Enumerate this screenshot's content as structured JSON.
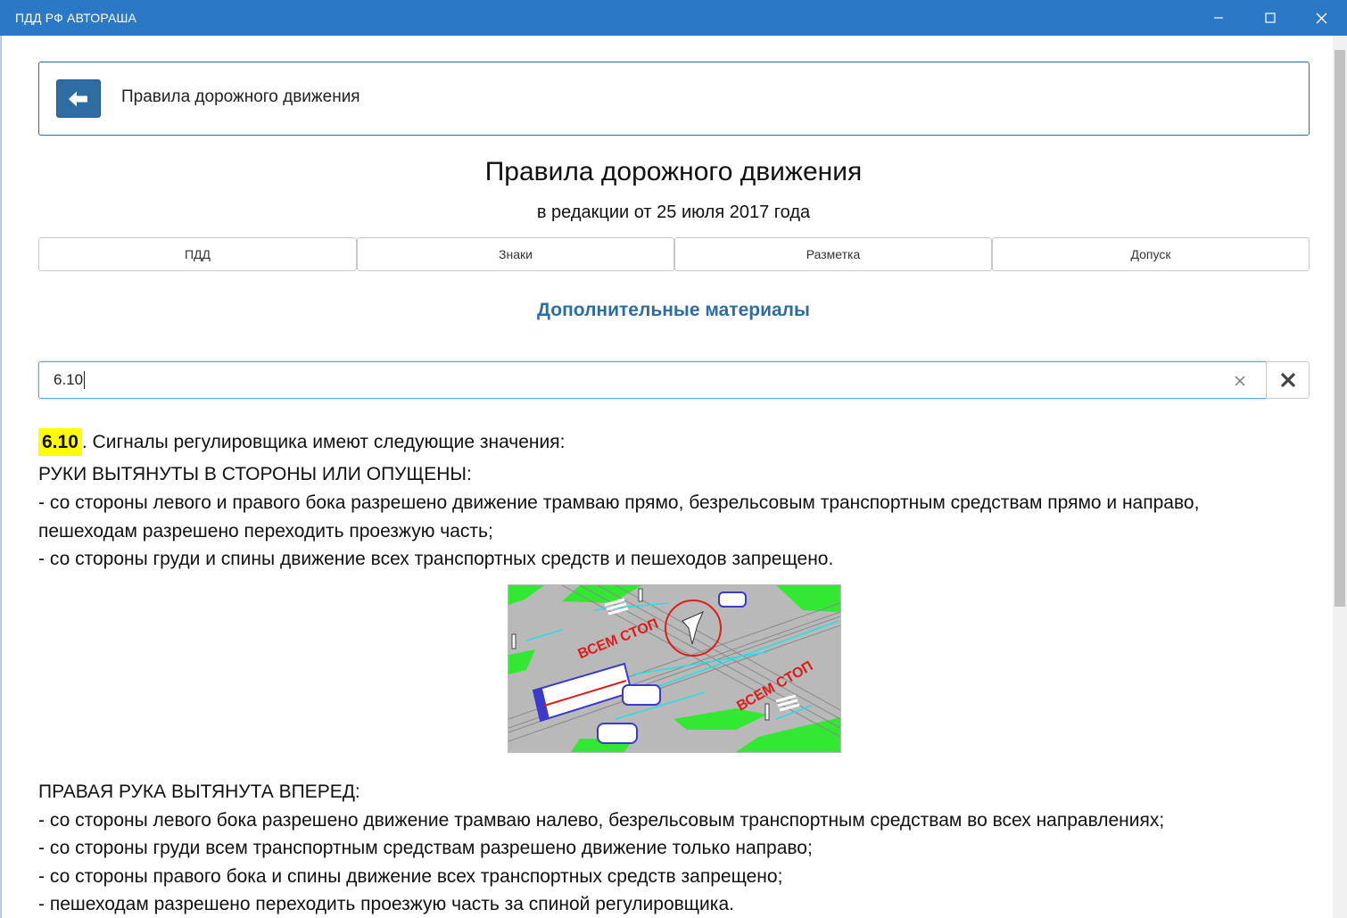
{
  "window": {
    "title": "ПДД РФ АВТОРАША",
    "controls": {
      "minimize": "minimize-icon",
      "maximize": "maximize-icon",
      "close": "close-icon"
    }
  },
  "header": {
    "back_icon": "arrow-left-icon",
    "title": "Правила дорожного движения"
  },
  "document": {
    "title": "Правила дорожного движения",
    "subtitle": "в редакции от 25 июля 2017 года"
  },
  "tabs": [
    {
      "label": "ПДД"
    },
    {
      "label": "Знаки"
    },
    {
      "label": "Разметка"
    },
    {
      "label": "Допуск"
    }
  ],
  "extra_link": "Дополнительные материалы",
  "search": {
    "value": "6.10",
    "clear_icon": "clear-x-icon",
    "reset_icon": "times-icon"
  },
  "rule": {
    "number": "6.10",
    "heading_rest": ". Сигналы регулировщика имеют следующие значения:",
    "section1_title": "РУКИ ВЫТЯНУТЫ В СТОРОНЫ ИЛИ ОПУЩЕНЫ:",
    "section1_lines": [
      "- со стороны левого и правого бока разрешено движение трамваю прямо, безрельсовым транспортным средствам прямо и направо,",
      "пешеходам разрешено переходить проезжую часть;",
      "- со стороны груди и спины движение всех транспортных средств и пешеходов запрещено."
    ],
    "illustration_text": [
      "ВСЕМ СТОП",
      "ВСЕМ СТОП"
    ],
    "section2_title": "ПРАВАЯ РУКА ВЫТЯНУТА ВПЕРЕД:",
    "section2_lines": [
      "- со стороны левого бока разрешено движение трамваю налево, безрельсовым транспортным средствам во всех направлениях;",
      "- со стороны груди всем транспортным средствам разрешено движение только направо;",
      "- со стороны правого бока и спины движение всех транспортных средств запрещено;",
      "- пешеходам разрешено переходить проезжую часть за спиной регулировщика."
    ]
  },
  "colors": {
    "titlebar": "#2b78c6",
    "accent": "#2e6da4",
    "highlight": "#ffff00",
    "grass": "#33e833",
    "road": "#b5b5b5",
    "stop_text": "#e01b1b"
  }
}
